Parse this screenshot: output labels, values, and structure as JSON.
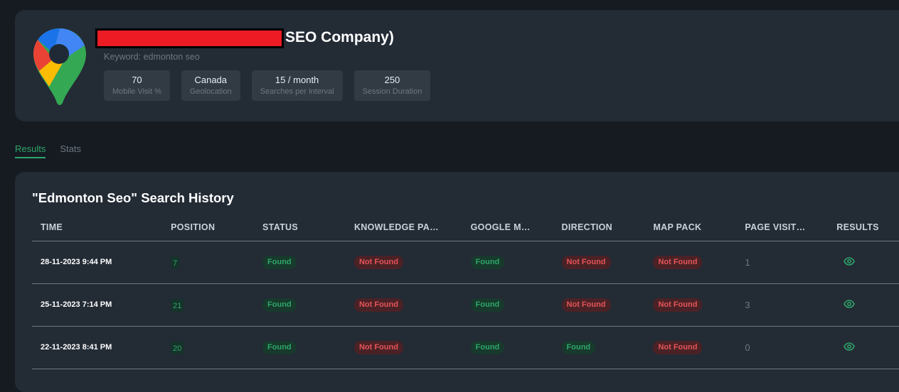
{
  "header": {
    "title_suffix": "SEO Company)",
    "keyword": "Keyword: edmonton seo",
    "stats": [
      {
        "value": "70",
        "label": "Mobile Visit %"
      },
      {
        "value": "Canada",
        "label": "Geolocation"
      },
      {
        "value": "15 / month",
        "label": "Searches per interval"
      },
      {
        "value": "250",
        "label": "Session Duration"
      }
    ]
  },
  "tabs": [
    {
      "label": "Results",
      "active": true
    },
    {
      "label": "Stats",
      "active": false
    }
  ],
  "results": {
    "title": "\"Edmonton Seo\" Search History",
    "columns": [
      "TIME",
      "POSITION",
      "STATUS",
      "KNOWLEDGE PA…",
      "GOOGLE M…",
      "DIRECTION",
      "MAP PACK",
      "PAGE VISIT…",
      "RESULTS"
    ],
    "rows": [
      {
        "time": "28-11-2023 9:44 PM",
        "position": "7",
        "status": "Found",
        "knowledge_panel": "Not Found",
        "google_maps": "Found",
        "direction": "Not Found",
        "map_pack": "Not Found",
        "page_visits": "1"
      },
      {
        "time": "25-11-2023 7:14 PM",
        "position": "21",
        "status": "Found",
        "knowledge_panel": "Not Found",
        "google_maps": "Found",
        "direction": "Not Found",
        "map_pack": "Not Found",
        "page_visits": "3"
      },
      {
        "time": "22-11-2023 8:41 PM",
        "position": "20",
        "status": "Found",
        "knowledge_panel": "Not Found",
        "google_maps": "Found",
        "direction": "Found",
        "map_pack": "Not Found",
        "page_visits": "0"
      }
    ]
  },
  "colors": {
    "found": "#2ea66a",
    "not_found": "#e55458",
    "background": "#161b22",
    "card": "#232b35"
  }
}
